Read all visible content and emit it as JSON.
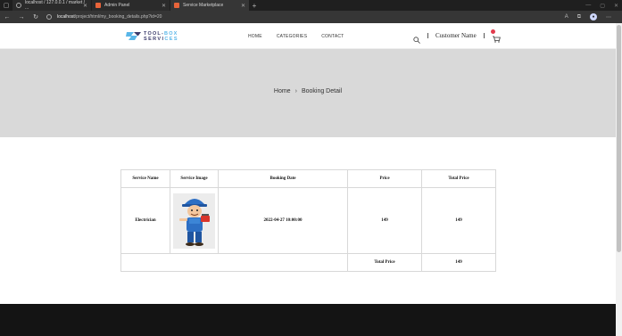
{
  "browser": {
    "tabs": [
      {
        "label": "localhost / 127.0.0.1 / market / ...",
        "icon": "github-icon"
      },
      {
        "label": "Admin Panel",
        "icon": "orange-square-icon"
      },
      {
        "label": "Service Marketplace",
        "icon": "orange-square-icon"
      }
    ],
    "url_host": "localhost",
    "url_path": "/project/html/my_booking_details.php?id=20"
  },
  "header": {
    "logo_line1_a": "TOOL-",
    "logo_line1_b": "BOX",
    "logo_line2_a": "SERVI",
    "logo_line2_b": "CES",
    "menu": [
      "HOME",
      "CATEGORIES",
      "CONTACT"
    ],
    "customer_name": "Customer Name"
  },
  "hero": {
    "breadcrumb_home": "Home",
    "breadcrumb_separator": "›",
    "breadcrumb_current": "Booking Detail"
  },
  "table": {
    "headers": [
      "Service Name",
      "Service Image",
      "Booking Date",
      "Price",
      "Total Price"
    ],
    "row": {
      "service_name": "Electrician",
      "booking_date": "2022-04-27 10:00:00",
      "price": "149",
      "total_price": "149"
    },
    "total_label": "Total Price",
    "total_value": "149"
  },
  "colors": {
    "hero_bg": "#d9d9d9",
    "footer_bg": "#141414",
    "logo_accent": "#59b6e8",
    "cart_badge": "#e23b4d"
  }
}
